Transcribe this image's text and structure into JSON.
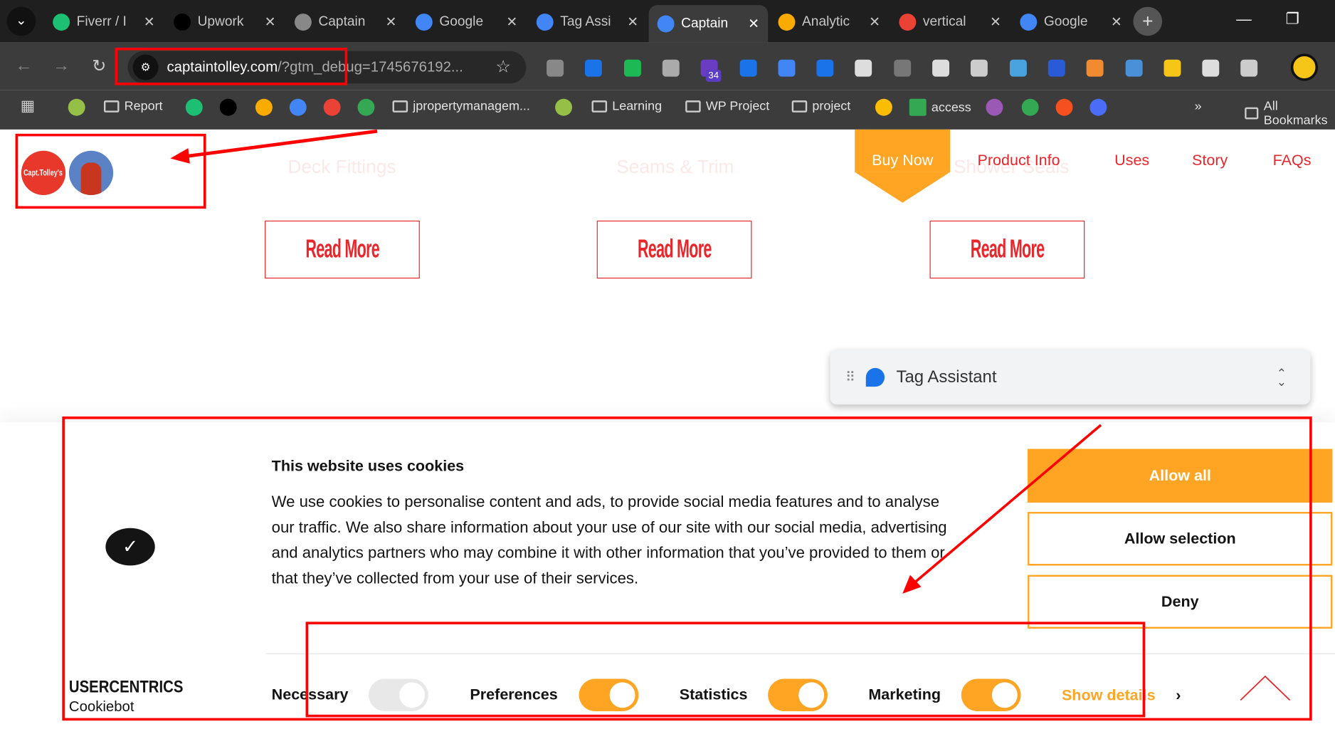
{
  "browser": {
    "tabs": [
      {
        "label": "Fiverr / I",
        "color": "#1dbf73"
      },
      {
        "label": "Upwork",
        "color": "#000"
      },
      {
        "label": "Captain",
        "color": "#888"
      },
      {
        "label": "Google",
        "color": "#4285f4"
      },
      {
        "label": "Tag Assi",
        "color": "#4285f4"
      },
      {
        "label": "Captain",
        "color": "#4285f4",
        "active": true
      },
      {
        "label": "Analytic",
        "color": "#f9ab00"
      },
      {
        "label": "vertical",
        "color": "#ea4335"
      },
      {
        "label": "Google",
        "color": "#4285f4"
      }
    ],
    "url_host": "captaintolley.com",
    "url_rest": "/?gtm_debug=1745676192...",
    "ext_badge": "34",
    "bookmarks": [
      "Report",
      "jpropertymanagem...",
      "Learning",
      "WP Project",
      "project",
      "access",
      "All Bookmarks"
    ]
  },
  "site": {
    "logo_text": "Capt.Tolley's",
    "faint_items": [
      "Deck Fittings",
      "Seams & Trim",
      "Shower Seals"
    ],
    "buy_now": "Buy Now",
    "nav": [
      "Product Info",
      "Uses",
      "Story",
      "FAQs"
    ],
    "read_more": "Read More"
  },
  "tag_assistant": {
    "title": "Tag Assistant"
  },
  "cookie": {
    "title": "This website uses cookies",
    "body": "We use cookies to personalise content and ads, to provide social media features and to analyse our traffic. We also share information about your use of our site with our social media, advertising and analytics partners who may combine it with other information that you’ve provided to them or that they’ve collected from your use of their services.",
    "allow_all": "Allow all",
    "allow_selection": "Allow selection",
    "deny": "Deny",
    "brand": "USERCENTRICS",
    "brand_sub": "Cookiebot",
    "toggles": [
      {
        "label": "Necessary",
        "on": true,
        "disabled": true
      },
      {
        "label": "Preferences",
        "on": true
      },
      {
        "label": "Statistics",
        "on": true
      },
      {
        "label": "Marketing",
        "on": true
      }
    ],
    "show_details": "Show details",
    "accent": "#ffa523"
  }
}
